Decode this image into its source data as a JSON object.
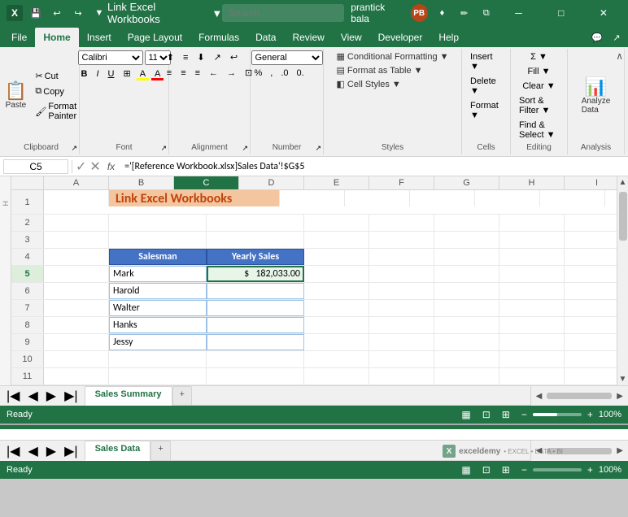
{
  "titlebar": {
    "title": "Link Excel Workbooks",
    "user": "prantick bala",
    "user_initials": "PB",
    "search_placeholder": "Search"
  },
  "ribbon": {
    "tabs": [
      "File",
      "Home",
      "Insert",
      "Page Layout",
      "Formulas",
      "Data",
      "Review",
      "View",
      "Developer",
      "Help"
    ],
    "active_tab": "Home",
    "groups": {
      "clipboard": {
        "label": "Clipboard",
        "paste": "Paste",
        "cut": "✂",
        "copy": "⧉",
        "format_painter": "🖌"
      },
      "font": {
        "label": "Font",
        "name": "Font"
      },
      "alignment": {
        "label": "Alignment",
        "name": "Alignment"
      },
      "number": {
        "label": "Number",
        "name": "Number"
      },
      "styles": {
        "label": "Styles",
        "conditional": "Conditional Formatting",
        "format_table": "Format as Table",
        "cell_styles": "Cell Styles"
      },
      "cells": {
        "label": "Cells",
        "name": "Cells"
      },
      "editing": {
        "label": "Editing",
        "name": "Editing"
      },
      "analysis": {
        "label": "Analysis",
        "name": "Analyze Data"
      }
    }
  },
  "formula_bar": {
    "cell_ref": "C5",
    "formula": "='[Reference Workbook.xlsx]Sales Data'!$G$5",
    "fx": "fx"
  },
  "spreadsheet": {
    "columns": [
      "",
      "A",
      "B",
      "C",
      "D",
      "E",
      "F",
      "G",
      "H",
      "I"
    ],
    "title_cell": "Link Excel Workbooks",
    "table": {
      "headers": [
        "Salesman",
        "Yearly Sales"
      ],
      "rows": [
        [
          "Mark",
          "$",
          "182,033.00"
        ],
        [
          "Harold",
          "",
          ""
        ],
        [
          "Walter",
          "",
          ""
        ],
        [
          "Hanks",
          "",
          ""
        ],
        [
          "Jessy",
          "",
          ""
        ]
      ]
    }
  },
  "sheet_tabs": {
    "tabs": [
      "Sales Summary"
    ],
    "active": "Sales Summary",
    "add_label": "+"
  },
  "status": {
    "ready": "Ready",
    "zoom": "100%"
  },
  "bottom_window": {
    "sheet_tab": "Sales Data",
    "status": "Ready",
    "zoom": "100%"
  }
}
